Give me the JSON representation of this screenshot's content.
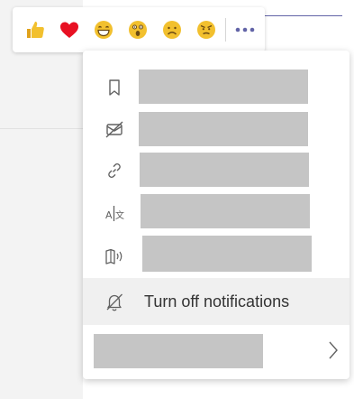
{
  "reactions": [
    {
      "name": "like",
      "icon": "thumbs-up-icon"
    },
    {
      "name": "heart",
      "icon": "heart-icon"
    },
    {
      "name": "laugh",
      "icon": "laughing-face-icon"
    },
    {
      "name": "surprised",
      "icon": "surprised-face-icon"
    },
    {
      "name": "sad",
      "icon": "sad-face-icon"
    },
    {
      "name": "angry",
      "icon": "angry-face-icon"
    }
  ],
  "more_options": {
    "icon": "more-horizontal-icon"
  },
  "menu": {
    "items": [
      {
        "icon": "bookmark-icon",
        "label": ""
      },
      {
        "icon": "mark-unread-icon",
        "label": ""
      },
      {
        "icon": "link-icon",
        "label": ""
      },
      {
        "icon": "translate-icon",
        "label": ""
      },
      {
        "icon": "immersive-reader-icon",
        "label": ""
      },
      {
        "icon": "bell-off-icon",
        "label": "Turn off notifications"
      },
      {
        "icon": "chevron-right-icon",
        "label": ""
      }
    ]
  },
  "colors": {
    "accent": "#6264a7",
    "emoji_yellow": "#f2c02e",
    "heart_red": "#e81123",
    "redacted": "#c5c5c5",
    "hover": "#f0f0f0"
  }
}
